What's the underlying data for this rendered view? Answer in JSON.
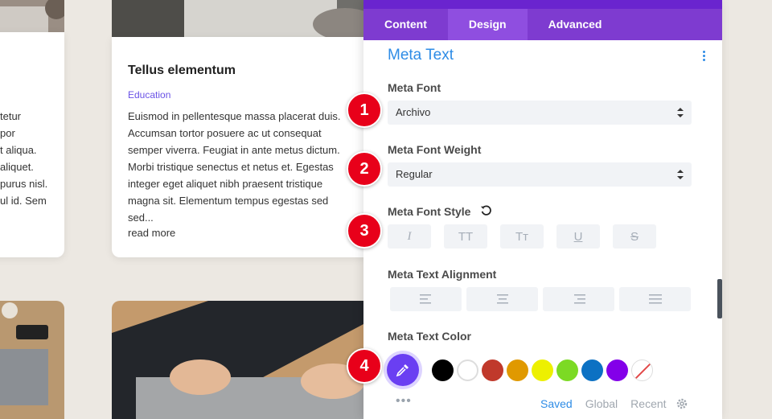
{
  "posts": {
    "left_card_fragments": [
      "tetur",
      "por",
      "t aliqua.",
      "aliquet.",
      "purus nisl.",
      "ul id. Sem"
    ],
    "main_card": {
      "title": "Tellus elementum",
      "category": "Education",
      "excerpt": "Euismod in pellentesque massa placerat duis. Accumsan tortor posuere ac ut consequat semper viverra. Feugiat in ante metus dictum. Morbi tristique senectus et netus et. Egestas integer eget aliquet nibh praesent tristique magna sit. Elementum tempus egestas sed sed...",
      "read_more": "read more"
    }
  },
  "panel": {
    "tabs": [
      {
        "label": "Content",
        "active": false
      },
      {
        "label": "Design",
        "active": true
      },
      {
        "label": "Advanced",
        "active": false
      }
    ],
    "section_title": "Meta Text",
    "meta_font": {
      "label": "Meta Font",
      "value": "Archivo"
    },
    "meta_font_weight": {
      "label": "Meta Font Weight",
      "value": "Regular"
    },
    "meta_font_style": {
      "label": "Meta Font Style",
      "buttons": [
        "I",
        "TT",
        "Tт",
        "U",
        "S"
      ]
    },
    "meta_text_alignment": {
      "label": "Meta Text Alignment"
    },
    "meta_text_color": {
      "label": "Meta Text Color",
      "swatches": [
        "#000000",
        "#ffffff",
        "#c0392b",
        "#e09900",
        "#edf000",
        "#7cda24",
        "#0c71c3",
        "#8300e9"
      ]
    },
    "footer": {
      "saved": "Saved",
      "global": "Global",
      "recent": "Recent"
    },
    "dots": "•••"
  },
  "badges": [
    "1",
    "2",
    "3",
    "4"
  ],
  "colors": {
    "accent_purple": "#7e3bd0",
    "accent_blue": "#2e8ce6",
    "badge_red": "#e8001a"
  }
}
